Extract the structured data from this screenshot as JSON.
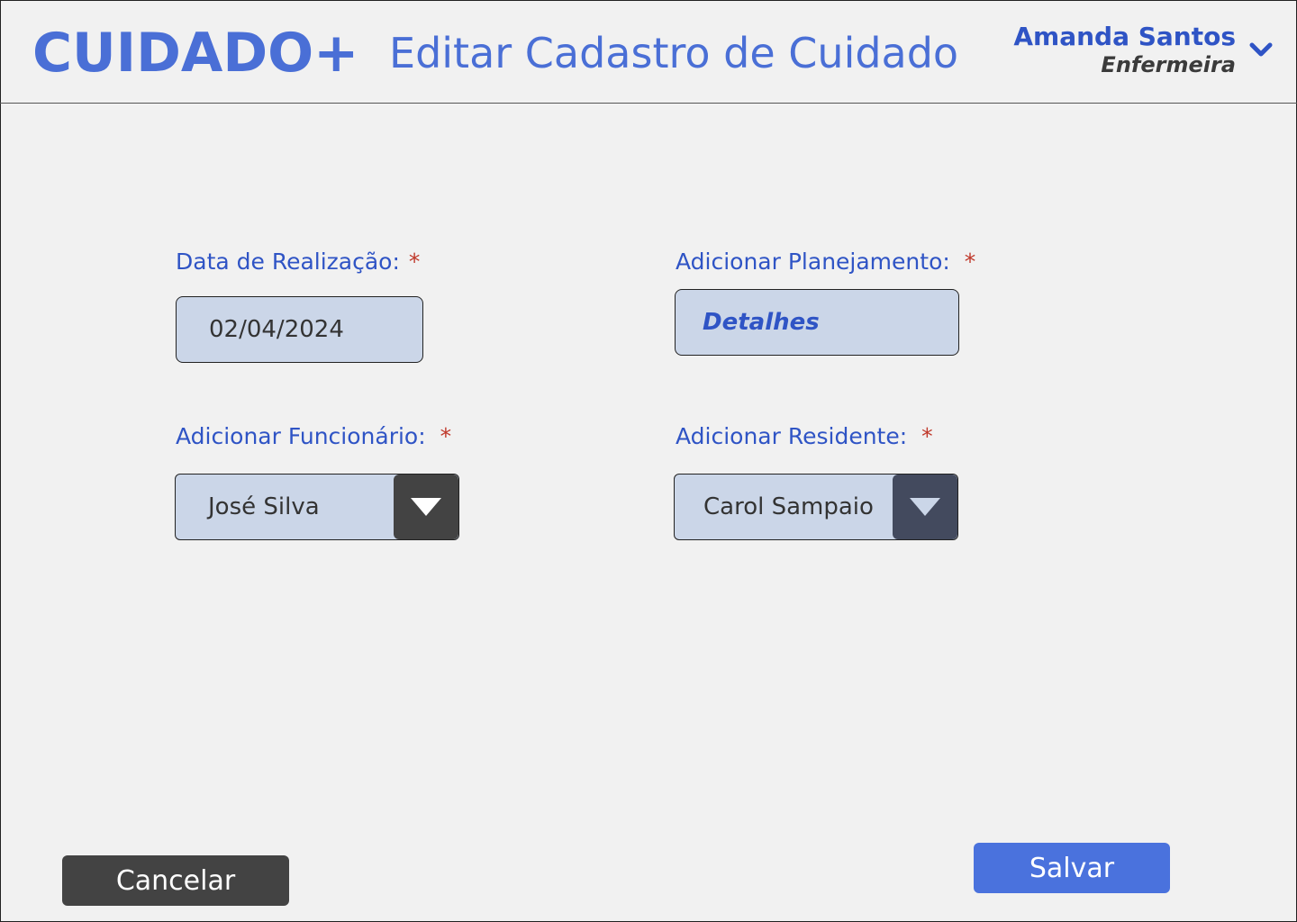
{
  "header": {
    "logo": "CUIDADO+",
    "title": "Editar Cadastro de Cuidado",
    "user": {
      "name": "Amanda Santos",
      "role": "Enfermeira",
      "menu_icon": "chevron-down-icon"
    }
  },
  "form": {
    "date": {
      "label": "Data de Realização:",
      "required_mark": "*",
      "value": "02/04/2024"
    },
    "planning": {
      "label": "Adicionar Planejamento:",
      "required_mark": "*",
      "button_label": "Detalhes"
    },
    "employee": {
      "label": "Adicionar Funcionário:",
      "required_mark": "*",
      "selected": "José Silva",
      "dropdown_icon": "triangle-down-icon"
    },
    "resident": {
      "label": "Adicionar Residente:",
      "required_mark": "*",
      "selected": "Carol Sampaio",
      "dropdown_icon": "triangle-down-icon"
    }
  },
  "actions": {
    "cancel_label": "Cancelar",
    "save_label": "Salvar"
  },
  "colors": {
    "brand": "#4a6fd6",
    "label": "#2f54c5",
    "field_bg": "#cbd6e8",
    "required": "#c0392b",
    "cancel_bg": "#434343",
    "save_bg": "#4a72dd",
    "employee_dropdown_btn": "#434343",
    "resident_dropdown_btn": "#434a5e"
  }
}
